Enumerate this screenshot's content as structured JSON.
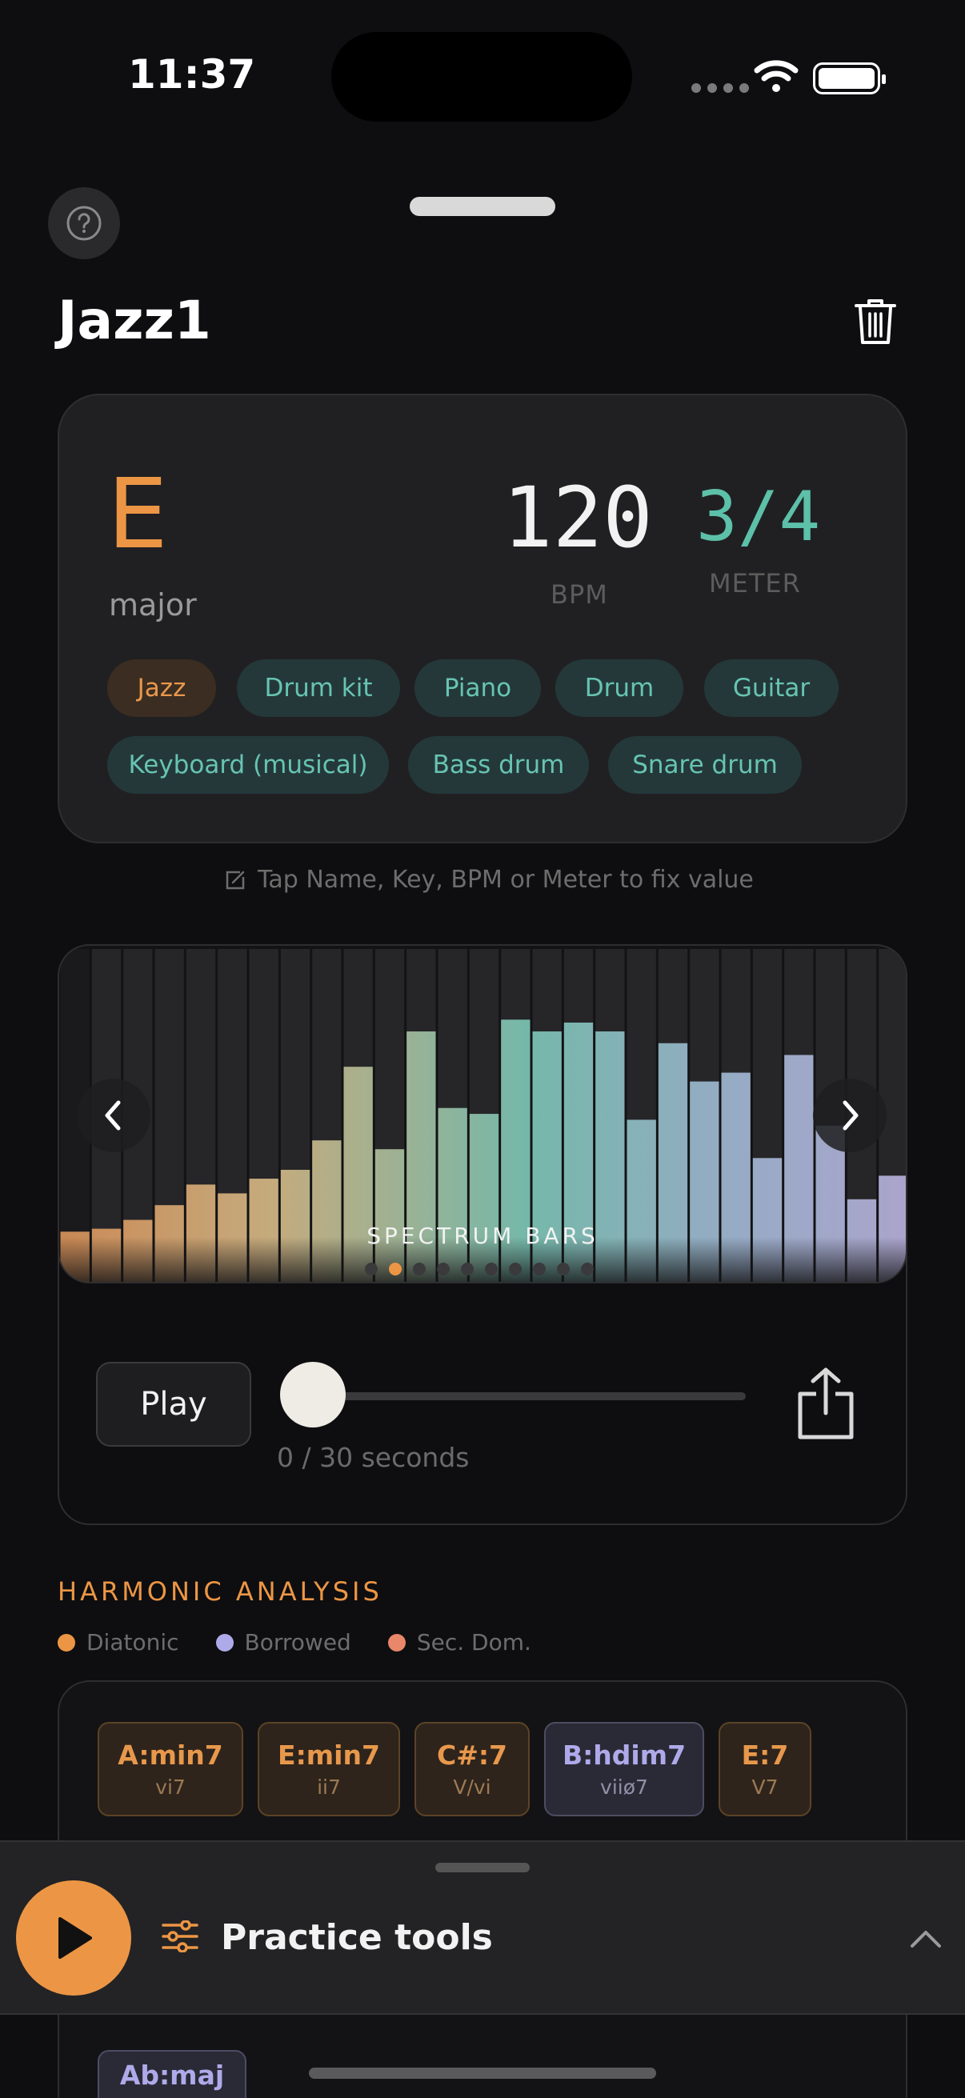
{
  "status": {
    "time": "11:37"
  },
  "song": {
    "title": "Jazz1",
    "key": "E",
    "mode": "major",
    "bpm": "120",
    "bpm_label": "BPM",
    "meter": "3/4",
    "meter_label": "METER"
  },
  "tags": [
    {
      "label": "Jazz",
      "active": true
    },
    {
      "label": "Drum kit",
      "active": false
    },
    {
      "label": "Piano",
      "active": false
    },
    {
      "label": "Drum",
      "active": false
    },
    {
      "label": "Guitar",
      "active": false
    },
    {
      "label": "Keyboard (musical)",
      "active": false
    },
    {
      "label": "Bass drum",
      "active": false
    },
    {
      "label": "Snare drum",
      "active": false
    }
  ],
  "hint": "Tap Name, Key, BPM or Meter to fix value",
  "visualizer": {
    "label": "SPECTRUM BARS",
    "page_count": 10,
    "active_page": 1,
    "levels": [
      0.04,
      0.05,
      0.08,
      0.13,
      0.2,
      0.17,
      0.22,
      0.25,
      0.35,
      0.6,
      0.32,
      0.72,
      0.46,
      0.44,
      0.76,
      0.72,
      0.75,
      0.72,
      0.42,
      0.68,
      0.55,
      0.58,
      0.29,
      0.64,
      0.4,
      0.15,
      0.23
    ]
  },
  "player": {
    "play_label": "Play",
    "progress": "0 / 30 seconds",
    "position": 0.0
  },
  "harmonic": {
    "title": "HARMONIC ANALYSIS",
    "legend": [
      {
        "label": "Diatonic",
        "color": "#ec9645"
      },
      {
        "label": "Borrowed",
        "color": "#aeaaea"
      },
      {
        "label": "Sec. Dom.",
        "color": "#e8876a"
      }
    ],
    "chords": [
      {
        "name": "A:min7",
        "roman": "vi7",
        "type": "diatonic"
      },
      {
        "name": "E:min7",
        "roman": "ii7",
        "type": "diatonic"
      },
      {
        "name": "C#:7",
        "roman": "V/vi",
        "type": "diatonic"
      },
      {
        "name": "B:hdim7",
        "roman": "viiø7",
        "type": "borrowed"
      },
      {
        "name": "E:7",
        "roman": "V7",
        "type": "diatonic"
      }
    ],
    "last_chord": {
      "name": "Ab:maj",
      "type": "borrowed"
    }
  },
  "practice": {
    "label": "Practice tools"
  },
  "colors": {
    "accent": "#ec9645",
    "teal": "#5dc0a9",
    "background": "#0e0e10"
  }
}
